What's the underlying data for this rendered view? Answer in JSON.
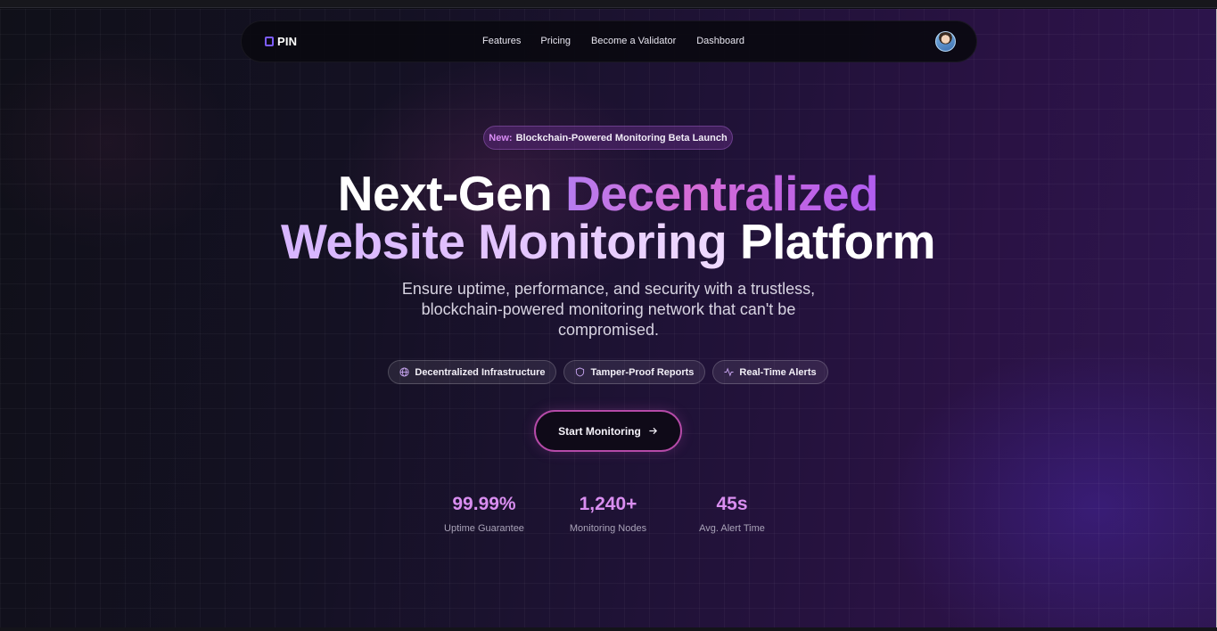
{
  "navbar": {
    "brand": "PIN",
    "links": [
      "Features",
      "Pricing",
      "Become a Validator",
      "Dashboard"
    ]
  },
  "badge": {
    "prefix": "New:",
    "text": "Blockchain-Powered Monitoring Beta Launch"
  },
  "headline": {
    "line1_white": "Next-Gen ",
    "line1_gradient": "Decentralized",
    "line2_gradient": "Website Monitoring ",
    "line2_white": "Platform"
  },
  "subtitle": "Ensure uptime, performance, and security with a trustless, blockchain-powered monitoring network that can't be compromised.",
  "features": [
    {
      "icon": "globe-icon",
      "label": "Decentralized Infrastructure"
    },
    {
      "icon": "shield-icon",
      "label": "Tamper-Proof Reports"
    },
    {
      "icon": "activity-icon",
      "label": "Real-Time Alerts"
    }
  ],
  "cta": {
    "label": "Start Monitoring",
    "icon": "arrow-right-icon"
  },
  "stats": [
    {
      "value": "99.99%",
      "label": "Uptime Guarantee"
    },
    {
      "value": "1,240+",
      "label": "Monitoring Nodes"
    },
    {
      "value": "45s",
      "label": "Avg. Alert Time"
    }
  ],
  "colors": {
    "accent": "#b54aa8",
    "brand_mark": "#7c5cff",
    "stat": "#d98ef0",
    "badge_prefix": "#d98cf5"
  }
}
